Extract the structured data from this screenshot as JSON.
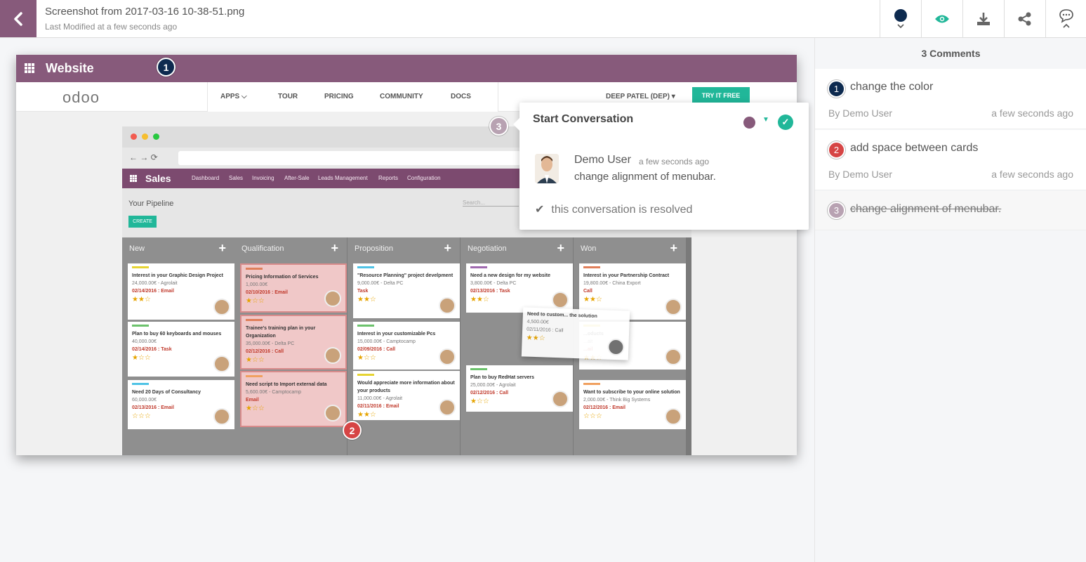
{
  "file": {
    "title": "Screenshot from 2017-03-16 10-38-51.png",
    "subtitle": "Last Modified at a few seconds ago"
  },
  "toolbar": {
    "items": [
      "color-picker-icon",
      "eye-icon",
      "download-icon",
      "share-icon",
      "comment-icon"
    ],
    "color": "#0d2a4f",
    "eye_color": "#21b799"
  },
  "screenshot": {
    "app_title": "Website",
    "logo": "odoo",
    "nav": [
      "APPS",
      "TOUR",
      "PRICING",
      "COMMUNITY",
      "DOCS"
    ],
    "user": "DEEP PATEL (DEP) ▾",
    "try_free": "TRY IT FREE",
    "sales": {
      "title": "Sales",
      "menu": [
        "Dashboard",
        "Sales",
        "Invoicing",
        "After-Sale",
        "Leads Management",
        "Reports",
        "Configuration"
      ],
      "pipeline": "Your Pipeline",
      "create": "CREATE",
      "search": "Search..."
    },
    "columns": [
      {
        "name": "New",
        "cards": [
          {
            "title": "Interest in your Graphic Design Project",
            "meta": "24,000.00€ - Agrolait",
            "deadline": "02/14/2016 : Email",
            "stars": "★★☆",
            "tag": "#e6d432"
          },
          {
            "title": "Plan to buy 60 keyboards and mouses",
            "meta": "40,000.00€",
            "deadline": "02/14/2016 : Task",
            "stars": "★☆☆",
            "tag": "#6cc26c"
          },
          {
            "title": "Need 20 Days of Consultancy",
            "meta": "60,000.00€",
            "deadline": "02/13/2016 : Email",
            "stars": "☆☆☆",
            "tag": "#4fc3e6"
          }
        ]
      },
      {
        "name": "Qualification",
        "cards": [
          {
            "title": "Pricing Information of Services",
            "meta": "1,000.00€",
            "deadline": "02/10/2016 : Email",
            "stars": "★☆☆",
            "tag": "#e07f5a"
          },
          {
            "title": "Trainee's training plan in your Organization",
            "meta": "35,000.00€ - Delta PC",
            "deadline": "02/12/2016 : Call",
            "stars": "★☆☆",
            "tag": "#e07f5a"
          },
          {
            "title": "Need script to Import external data",
            "meta": "5,600.00€ - Camptocamp",
            "deadline": "Email",
            "stars": "★☆☆",
            "tag": "#f0a060"
          }
        ]
      },
      {
        "name": "Proposition",
        "cards": [
          {
            "title": "\"Resource Planning\" project develpment",
            "meta": "9,000.00€ - Delta PC",
            "deadline": "Task",
            "stars": "★★☆",
            "tag": "#4fc3e6"
          },
          {
            "title": "Interest in your customizable Pcs",
            "meta": "15,000.00€ - Camptocamp",
            "deadline": "02/09/2016 : Call",
            "stars": "★☆☆",
            "tag": "#6cc26c"
          },
          {
            "title": "Would appreciate more information about your products",
            "meta": "11,000.00€ - Agrolait",
            "deadline": "02/11/2016 : Email",
            "stars": "★★☆",
            "tag": "#e6d432"
          }
        ]
      },
      {
        "name": "Negotiation",
        "cards": [
          {
            "title": "Need a new design for my website",
            "meta": "3,800.00€ - Delta PC",
            "deadline": "02/13/2016 : Task",
            "stars": "★★☆",
            "tag": "#a06ab0"
          },
          {
            "title": "Plan to buy RedHat servers",
            "meta": "25,000.00€ - Agrolait",
            "deadline": "02/12/2016 : Call",
            "stars": "★☆☆",
            "tag": "#6cc26c"
          }
        ]
      },
      {
        "name": "Won",
        "cards": [
          {
            "title": "Interest in your Partnership Contract",
            "meta": "19,800.00€ - China Export",
            "deadline": "Call",
            "stars": "★★☆",
            "tag": "#e07f5a"
          },
          {
            "title": "...oducts",
            "meta": "...ait",
            "deadline": "...ail",
            "stars": "★★☆",
            "tag": "#e6d432"
          },
          {
            "title": "Want to subscribe to your online solution",
            "meta": "2,000.00€ - Think Big Systems",
            "deadline": "02/12/2016 : Email",
            "stars": "☆☆☆",
            "tag": "#f0a060"
          }
        ]
      }
    ],
    "dragged_card": {
      "title": "Need to custom... the solution",
      "meta": "4,500.00€",
      "deadline": "02/11/2016 : Call",
      "stars": "★★☆"
    }
  },
  "markers": [
    {
      "num": "1",
      "color": "#0d2a4f"
    },
    {
      "num": "2",
      "color": "#d64545"
    },
    {
      "num": "3",
      "color": "#b8a2b2"
    }
  ],
  "popover": {
    "title": "Start Conversation",
    "user": "Demo User",
    "time": "a few seconds ago",
    "message": "change alignment of menubar.",
    "resolved": "this conversation is resolved"
  },
  "sidebar": {
    "heading": "3 Comments",
    "comments": [
      {
        "num": "1",
        "text": "change the color",
        "by": "By Demo User",
        "time": "a few seconds ago",
        "color": "#0d2a4f"
      },
      {
        "num": "2",
        "text": "add space between cards",
        "by": "By Demo User",
        "time": "a few seconds ago",
        "color": "#d64545"
      },
      {
        "num": "3",
        "text": "change alignment of menubar.",
        "color": "#b8a2b2",
        "resolved": true
      }
    ]
  }
}
